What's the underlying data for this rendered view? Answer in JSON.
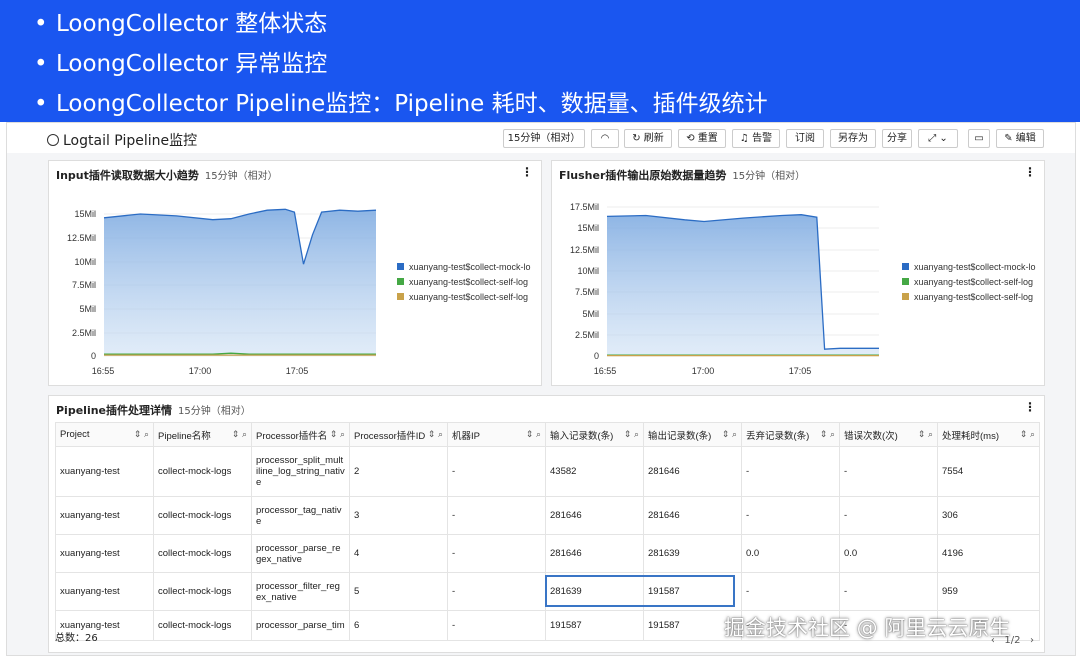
{
  "banner": {
    "bullets": [
      "LoongCollector 整体状态",
      "LoongCollector 异常监控",
      "LoongCollector Pipeline监控：Pipeline 耗时、数据量、插件级统计"
    ]
  },
  "dashboard": {
    "title": "Logtail Pipeline监控",
    "toolbar": {
      "time_range": "15分钟（相对）",
      "refresh": "刷新",
      "reset": "重置",
      "alert": "告警",
      "subscribe": "订阅",
      "save_as": "另存为",
      "share": "分享",
      "edit": "编辑"
    }
  },
  "charts": {
    "input": {
      "title": "Input插件读取数据大小趋势",
      "time": "15分钟（相对）",
      "legend": [
        "xuanyang-test$collect-mock-lo",
        "xuanyang-test$collect-self-log",
        "xuanyang-test$collect-self-log"
      ],
      "yticks": [
        "15Mil",
        "12.5Mil",
        "10Mil",
        "7.5Mil",
        "5Mil",
        "2.5Mil",
        "0"
      ],
      "xticks": [
        "16:55",
        "17:00",
        "17:05"
      ]
    },
    "flusher": {
      "title": "Flusher插件输出原始数据量趋势",
      "time": "15分钟（相对）",
      "legend": [
        "xuanyang-test$collect-mock-lo",
        "xuanyang-test$collect-self-log",
        "xuanyang-test$collect-self-log"
      ],
      "yticks": [
        "17.5Mil",
        "15Mil",
        "12.5Mil",
        "10Mil",
        "7.5Mil",
        "5Mil",
        "2.5Mil",
        "0"
      ],
      "xticks": [
        "16:55",
        "17:00",
        "17:05"
      ]
    }
  },
  "chart_data": [
    {
      "type": "area",
      "title": "Input插件读取数据大小趋势",
      "x": [
        "16:53",
        "16:55",
        "16:57",
        "16:59",
        "17:00",
        "17:01",
        "17:02",
        "17:03",
        "17:03.5",
        "17:04",
        "17:04.5",
        "17:05",
        "17:06",
        "17:07",
        "17:08"
      ],
      "ylim": [
        0,
        16000000
      ],
      "series": [
        {
          "name": "xuanyang-test$collect-mock-lo",
          "color": "#2b6cc4",
          "values": [
            14600000,
            15000000,
            14800000,
            14400000,
            14500000,
            15000000,
            15400000,
            15500000,
            15200000,
            9700000,
            12800000,
            15200000,
            15400000,
            15300000,
            15400000
          ]
        },
        {
          "name": "xuanyang-test$collect-self-log",
          "color": "#45a845",
          "values": [
            200000,
            200000,
            200000,
            200000,
            300000,
            200000,
            200000,
            200000,
            200000,
            200000,
            200000,
            200000,
            200000,
            200000,
            200000
          ]
        },
        {
          "name": "xuanyang-test$collect-self-log",
          "color": "#c9a24a",
          "values": [
            100000,
            100000,
            100000,
            100000,
            100000,
            100000,
            100000,
            100000,
            100000,
            100000,
            100000,
            100000,
            100000,
            100000,
            100000
          ]
        }
      ]
    },
    {
      "type": "area",
      "title": "Flusher插件输出原始数据量趋势",
      "x": [
        "16:54",
        "16:56",
        "16:58",
        "16:59",
        "17:01",
        "17:03",
        "17:04",
        "17:04.8",
        "17:05.2",
        "17:06",
        "17:08"
      ],
      "ylim": [
        0,
        18000000
      ],
      "series": [
        {
          "name": "xuanyang-test$collect-mock-lo",
          "color": "#2b6cc4",
          "values": [
            16400000,
            16500000,
            16000000,
            15800000,
            16200000,
            16500000,
            16600000,
            16300000,
            800000,
            900000,
            900000
          ]
        },
        {
          "name": "xuanyang-test$collect-self-log",
          "color": "#45a845",
          "values": [
            100000,
            100000,
            100000,
            100000,
            100000,
            100000,
            100000,
            100000,
            100000,
            100000,
            100000
          ]
        },
        {
          "name": "xuanyang-test$collect-self-log",
          "color": "#c9a24a",
          "values": [
            50000,
            50000,
            50000,
            50000,
            50000,
            50000,
            50000,
            50000,
            50000,
            50000,
            50000
          ]
        }
      ]
    }
  ],
  "table": {
    "title": "Pipeline插件处理详情",
    "time": "15分钟（相对）",
    "columns": [
      "Project",
      "Pipeline名称",
      "Processor插件名",
      "Processor插件ID",
      "机器IP",
      "输入记录数(条)",
      "输出记录数(条)",
      "丢弃记录数(条)",
      "错误次数(次)",
      "处理耗时(ms)"
    ],
    "rows": [
      [
        "xuanyang-test",
        "collect-mock-logs",
        "processor_split_multiline_log_string_native",
        "2",
        "-",
        "43582",
        "281646",
        "-",
        "-",
        "7554"
      ],
      [
        "xuanyang-test",
        "collect-mock-logs",
        "processor_tag_native",
        "3",
        "-",
        "281646",
        "281646",
        "-",
        "-",
        "306"
      ],
      [
        "xuanyang-test",
        "collect-mock-logs",
        "processor_parse_regex_native",
        "4",
        "-",
        "281646",
        "281639",
        "0.0",
        "0.0",
        "4196"
      ],
      [
        "xuanyang-test",
        "collect-mock-logs",
        "processor_filter_regex_native",
        "5",
        "-",
        "281639",
        "191587",
        "-",
        "-",
        "959"
      ],
      [
        "xuanyang-test",
        "collect-mock-logs",
        "processor_parse_tim",
        "6",
        "-",
        "191587",
        "191587",
        "-",
        "-",
        ""
      ]
    ],
    "total": "总数：26",
    "page": "1/2"
  },
  "watermark": "掘金技术社区 @ 阿里云云原生"
}
